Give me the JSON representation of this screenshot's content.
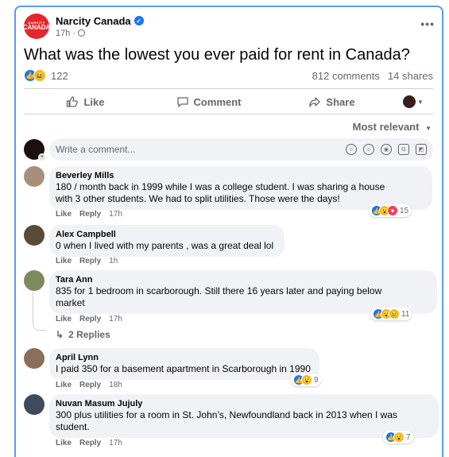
{
  "post": {
    "page_name": "Narcity Canada",
    "logo_line1": "NARCITY",
    "logo_line2": "CANADA",
    "time": "17h",
    "text": "What was the lowest you ever paid for rent in Canada?",
    "reaction_count": "122",
    "comments_count": "812 comments",
    "shares_count": "14 shares"
  },
  "actions": {
    "like": "Like",
    "comment": "Comment",
    "share": "Share"
  },
  "sort": {
    "label": "Most relevant"
  },
  "composer": {
    "placeholder": "Write a comment..."
  },
  "comments": [
    {
      "author": "Beverley Mills",
      "text_line1": "180 / month back in 1999 while I was a college student. I was sharing a house",
      "text_line2": "with 3 other students. We had to split utilities. Those were the days!",
      "like": "Like",
      "reply": "Reply",
      "time": "17h",
      "reaction_count": "15"
    },
    {
      "author": "Alex Campbell",
      "text_line1": "0 when I lived with my parents , was a great deal lol",
      "like": "Like",
      "reply": "Reply",
      "time": "1h"
    },
    {
      "author": "Tara Ann",
      "text_line1": "835 for 1 bedroom in scarborough. Still there 16 years later and paying below",
      "text_line2": "market",
      "like": "Like",
      "reply": "Reply",
      "time": "17h",
      "reaction_count": "11",
      "replies_label": "2 Replies"
    },
    {
      "author": "April Lynn",
      "text_line1": "I paid 350 for a basement apartment in Scarborough in 1990",
      "like": "Like",
      "reply": "Reply",
      "time": "18h",
      "reaction_count": "9"
    },
    {
      "author": "Nuvan Masum Jujuly",
      "text_line1": "300 plus utilities for a room in St. John’s, Newfoundland back in 2013 when I was",
      "text_line2": "student.",
      "like": "Like",
      "reply": "Reply",
      "time": "17h",
      "reaction_count": "7"
    }
  ]
}
